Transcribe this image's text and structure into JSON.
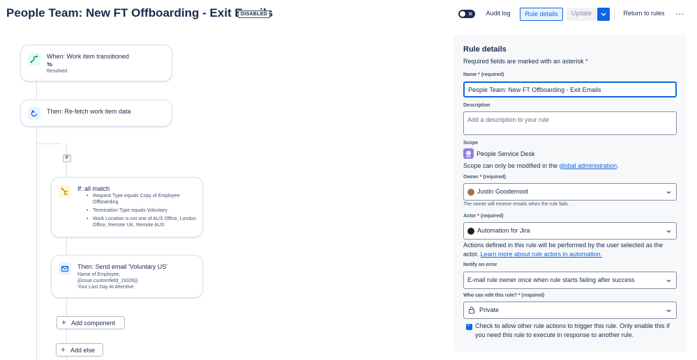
{
  "header": {
    "title": "People Team: New FT Offboarding - Exit Emails",
    "status_badge": "DISABLED",
    "audit_log": "Audit log",
    "rule_details": "Rule details",
    "update": "Update",
    "return_to_rules": "Return to rules",
    "more": "···"
  },
  "flow": {
    "trigger": {
      "title": "When: Work item transitioned",
      "to_label": "To",
      "to_value": "Resolved"
    },
    "refetch": {
      "title": "Then: Re-fetch work item data"
    },
    "if_badge": "IF",
    "condition": {
      "title": "If: all match",
      "items": [
        "Request Type equals Copy of Employee Offboarding",
        "Termination Type equals Voluntary",
        "Work Location is not one of AUS Office, London Office, Remote UK, Remote AUS"
      ]
    },
    "email": {
      "title": "Then: Send email 'Voluntary US'",
      "line1": "Name of Employee,",
      "line2": "{{issue.customfield_19326}}",
      "line3": "Your Last Day At Attentive"
    },
    "add_component": "Add component",
    "add_else": "Add else"
  },
  "panel": {
    "heading": "Rule details",
    "required_note": "Required fields are marked with an asterisk",
    "asterisk": "*",
    "name_label": "Name",
    "required": "(required)",
    "name_value": "People Team: New FT Offboarding - Exit Emails",
    "description_label": "Description",
    "description_placeholder": "Add a description to your rule",
    "scope_label": "Scope",
    "scope_value": "People Service Desk",
    "scope_note_prefix": "Scope can only be modified in the",
    "scope_note_link": "global administration",
    "scope_note_suffix": ".",
    "owner_label": "Owner",
    "owner_value": "Justin Goodemoot",
    "owner_help": "The owner will receive emails when the rule fails.",
    "actor_label": "Actor",
    "actor_value": "Automation for Jira",
    "actor_note": "Actions defined in this rule will be performed by the user selected as the actor.",
    "actor_link": "Learn more about rule actors in automation.",
    "notify_label": "Notify on error",
    "notify_value": "E-mail rule owner once when rule starts failing after success",
    "edit_label": "Who can edit this rule?",
    "edit_value": "Private",
    "checkbox_text": "Check to allow other rule actions to trigger this rule. Only enable this if you need this rule to execute in response to another rule."
  },
  "colors": {
    "accent": "#0c66e4",
    "text": "#172b4d",
    "border": "#dcdfe4"
  },
  "icons": [
    "branch-icon",
    "refresh-icon",
    "condition-icon",
    "mail-icon",
    "plus-icon",
    "chevron-down-icon",
    "lock-icon",
    "checkmark-icon",
    "close-icon",
    "more-icon"
  ]
}
